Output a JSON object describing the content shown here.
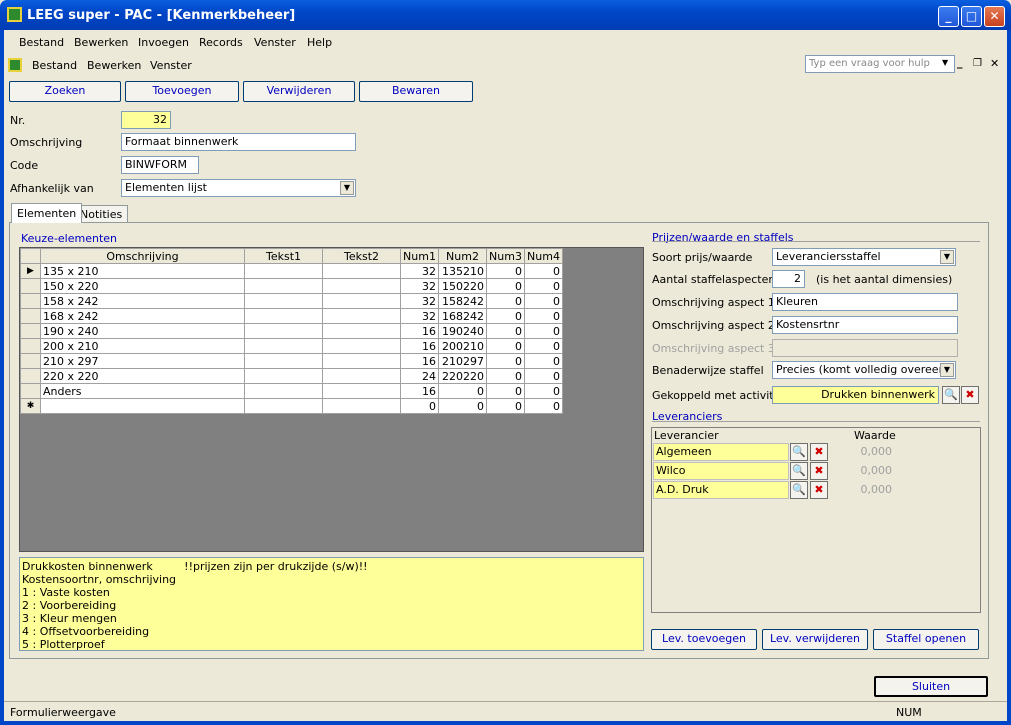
{
  "window": {
    "title": "LEEG super - PAC - [Kenmerkbeheer]",
    "minimize_icon": "minimize-icon",
    "maximize_icon": "maximize-icon",
    "close_icon": "close-icon"
  },
  "menubar": [
    "Bestand",
    "Bewerken",
    "Invoegen",
    "Records",
    "Venster",
    "Help"
  ],
  "menubar2": [
    "Bestand",
    "Bewerken",
    "Venster"
  ],
  "help_placeholder": "Typ een vraag voor hulp",
  "toolbar": {
    "zoeken": "Zoeken",
    "toevoegen": "Toevoegen",
    "verwijderen": "Verwijderen",
    "bewaren": "Bewaren"
  },
  "form": {
    "nr_label": "Nr.",
    "nr_value": "32",
    "omschrijving_label": "Omschrijving",
    "omschrijving_value": "Formaat binnenwerk",
    "code_label": "Code",
    "code_value": "BINWFORM",
    "afhankelijk_label": "Afhankelijk van",
    "afhankelijk_value": "Elementen lijst"
  },
  "tabs": [
    "Elementen",
    "Notities"
  ],
  "keuze": {
    "title": "Keuze-elementen",
    "columns": [
      "Omschrijving",
      "Tekst1",
      "Tekst2",
      "Num1",
      "Num2",
      "Num3",
      "Num4"
    ],
    "rows": [
      [
        "135 x 210",
        "",
        "",
        "32",
        "135210",
        "0",
        "0"
      ],
      [
        "150 x 220",
        "",
        "",
        "32",
        "150220",
        "0",
        "0"
      ],
      [
        "158 x 242",
        "",
        "",
        "32",
        "158242",
        "0",
        "0"
      ],
      [
        "168 x 242",
        "",
        "",
        "32",
        "168242",
        "0",
        "0"
      ],
      [
        "190 x 240",
        "",
        "",
        "16",
        "190240",
        "0",
        "0"
      ],
      [
        "200 x 210",
        "",
        "",
        "16",
        "200210",
        "0",
        "0"
      ],
      [
        "210 x 297",
        "",
        "",
        "16",
        "210297",
        "0",
        "0"
      ],
      [
        "220 x 220",
        "",
        "",
        "24",
        "220220",
        "0",
        "0"
      ],
      [
        "Anders",
        "",
        "",
        "16",
        "0",
        "0",
        "0"
      ]
    ],
    "new_row": [
      "",
      "",
      "",
      "0",
      "0",
      "0",
      "0"
    ]
  },
  "memo": "Drukkosten binnenwerk         !!prijzen zijn per drukzijde (s/w)!!\nKostensoortnr, omschrijving\n1 : Vaste kosten\n2 : Voorbereiding\n3 : Kleur mengen\n4 : Offsetvoorbereiding\n5 : Plotterproef",
  "prijzen": {
    "title": "Prijzen/waarde en staffels",
    "soort_label": "Soort prijs/waarde",
    "soort_value": "Leveranciersstaffel",
    "aantal_label": "Aantal staffelaspecten",
    "aantal_value": "2",
    "aantal_note": "(is het aantal dimensies)",
    "aspect1_label": "Omschrijving aspect 1",
    "aspect1_value": "Kleuren",
    "aspect2_label": "Omschrijving aspect 2",
    "aspect2_value": "Kostensrtnr",
    "aspect3_label": "Omschrijving aspect 3",
    "aspect3_value": "",
    "benader_label": "Benaderwijze staffel",
    "benader_value": "Precies (komt volledig overeen)",
    "gekoppeld_label": "Gekoppeld met activiteit",
    "gekoppeld_value": "Drukken binnenwerk"
  },
  "leveranciers": {
    "title": "Leveranciers",
    "col_name": "Leverancier",
    "col_value": "Waarde",
    "rows": [
      {
        "name": "Algemeen",
        "value": "0,000"
      },
      {
        "name": "Wilco",
        "value": "0,000"
      },
      {
        "name": "A.D. Druk",
        "value": "0,000"
      }
    ]
  },
  "bottom_buttons": {
    "lev_toevoegen": "Lev. toevoegen",
    "lev_verwijderen": "Lev. verwijderen",
    "staffel_openen": "Staffel openen"
  },
  "sluiten": "Sluiten",
  "status": {
    "left": "Formulierweergave",
    "right": "NUM"
  }
}
